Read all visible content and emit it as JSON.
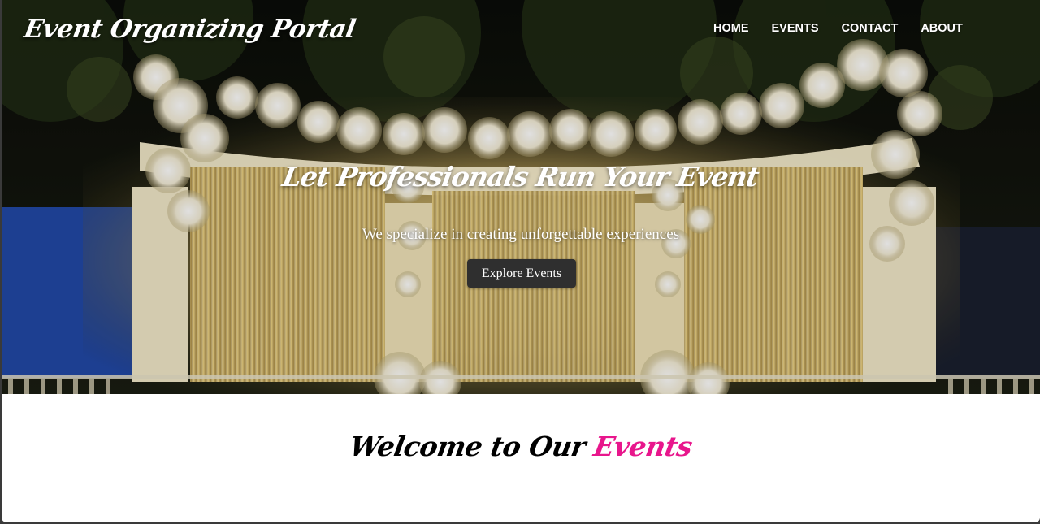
{
  "header": {
    "logo": "Event Organizing Portal",
    "nav": [
      {
        "label": "HOME"
      },
      {
        "label": "EVENTS"
      },
      {
        "label": "CONTACT"
      },
      {
        "label": "ABOUT"
      }
    ]
  },
  "hero": {
    "title": "Let Professionals Run Your Event",
    "subtitle": "We specialize in creating unforgettable experiences",
    "button_label": "Explore Events"
  },
  "welcome": {
    "prefix": "Welcome to Our",
    "highlight": "Events"
  },
  "colors": {
    "accent": "#e8168c",
    "button_bg": "#2f2f2f",
    "text_light": "#ffffff"
  }
}
